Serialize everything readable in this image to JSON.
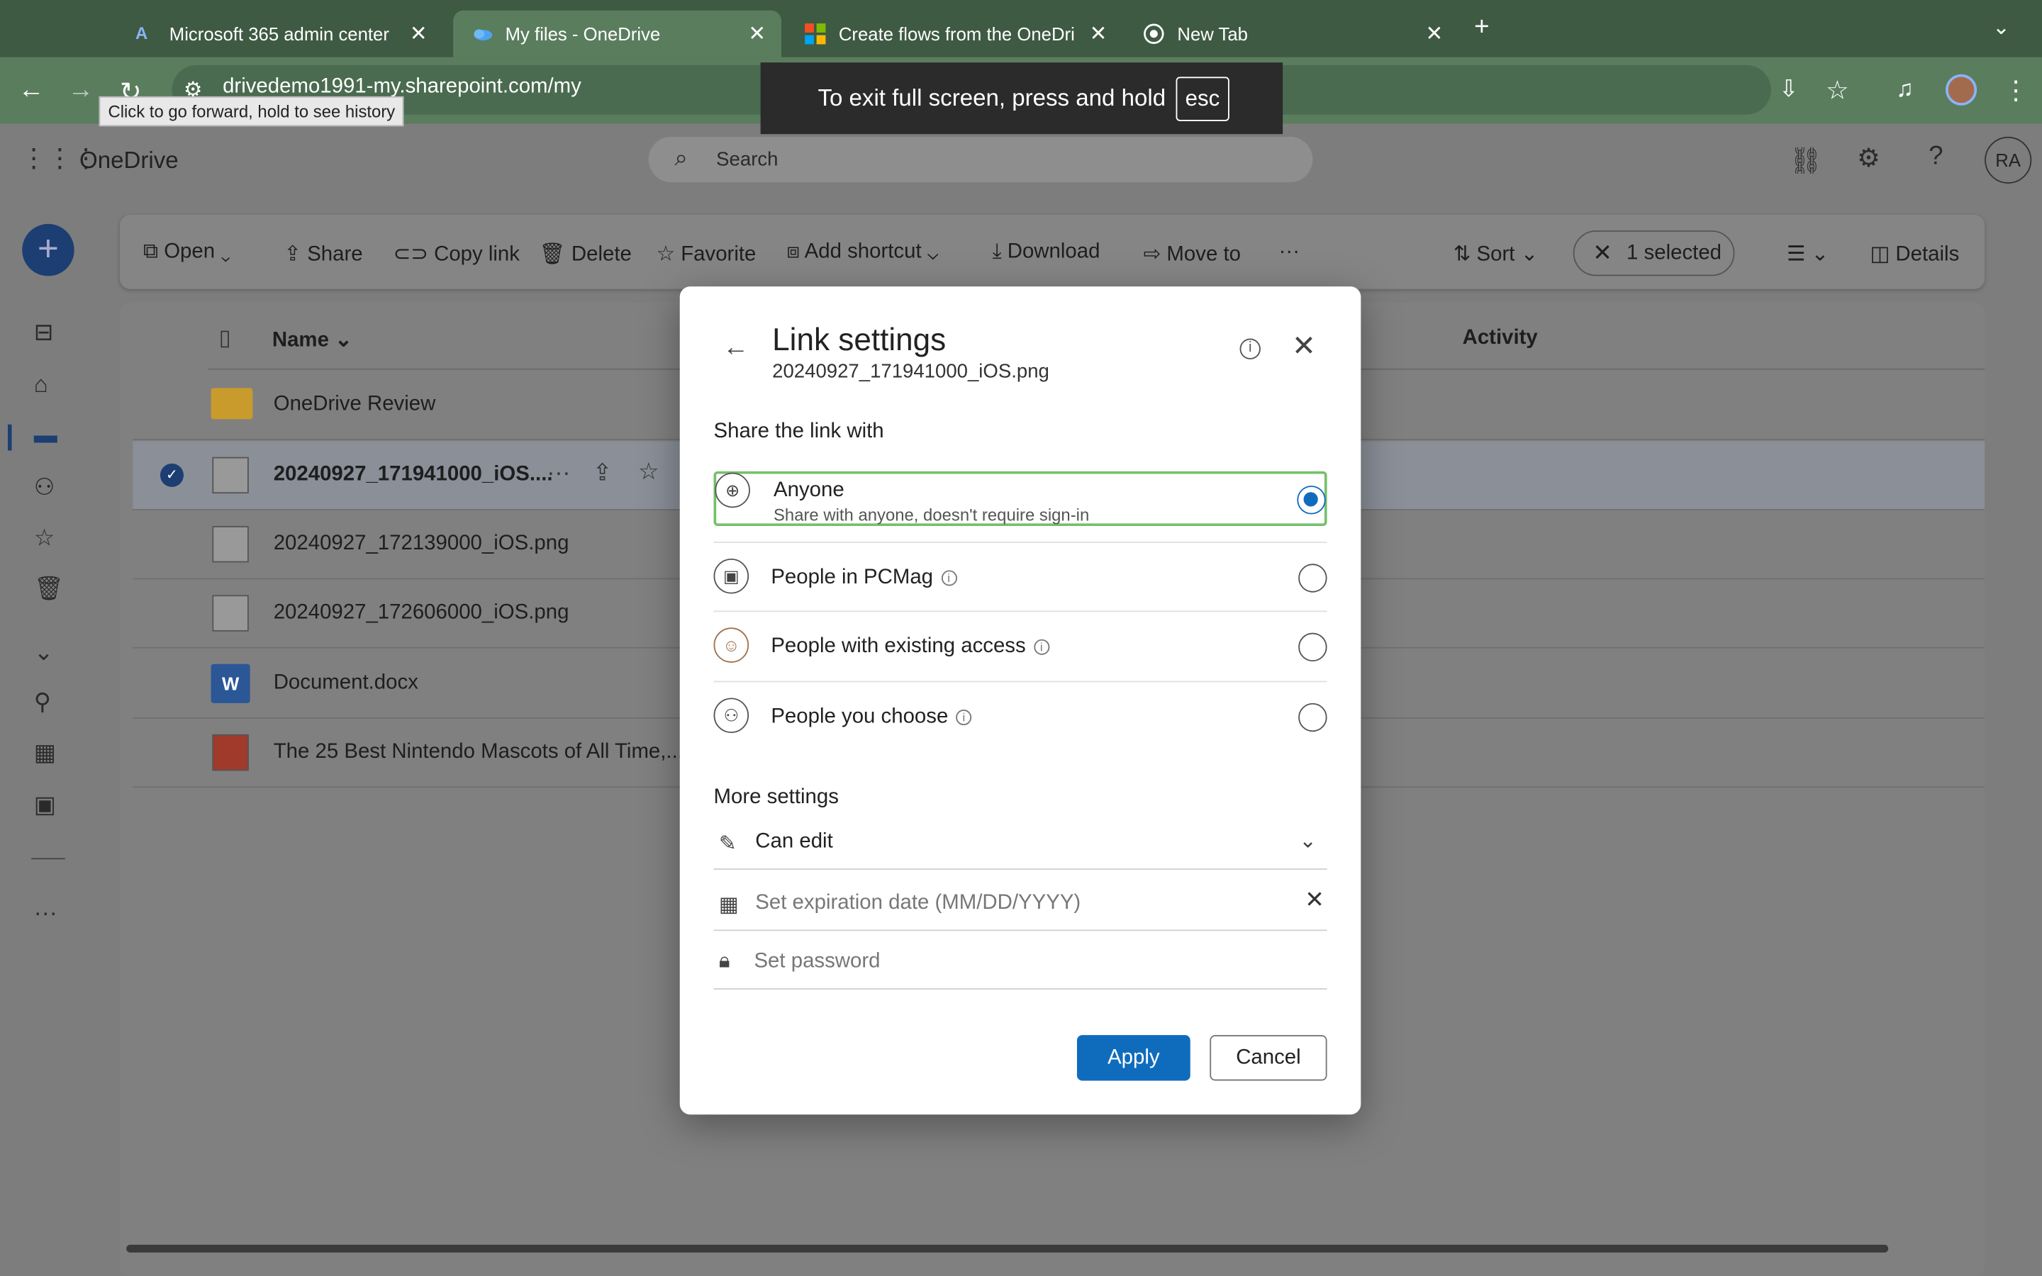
{
  "browser": {
    "tabs": [
      {
        "title": "Microsoft 365 admin center"
      },
      {
        "title": "My files - OneDrive"
      },
      {
        "title": "Create flows from the OneDri"
      },
      {
        "title": "New Tab"
      }
    ],
    "url": "drivedemo1991-my.sharepoint.com/my",
    "tooltip": "Click to go forward, hold to see history",
    "fullscreen_notice": "To exit full screen, press and hold",
    "fullscreen_key": "esc"
  },
  "app": {
    "name": "OneDrive",
    "search_placeholder": "Search",
    "avatar_initials": "RA"
  },
  "toolbar": {
    "open": "Open",
    "share": "Share",
    "copy_link": "Copy link",
    "delete": "Delete",
    "favorite": "Favorite",
    "add_shortcut": "Add shortcut",
    "download": "Download",
    "move_to": "Move to",
    "more": "···",
    "sort": "Sort",
    "selected": "1 selected",
    "details": "Details"
  },
  "list": {
    "col_name": "Name",
    "col_activity": "Activity",
    "rows": [
      {
        "name": "OneDrive Review",
        "type": "folder-icon"
      },
      {
        "name": "20240927_171941000_iOS....",
        "type": "image-file-icon"
      },
      {
        "name": "20240927_172139000_iOS.png",
        "type": "image-file-icon"
      },
      {
        "name": "20240927_172606000_iOS.png",
        "type": "image-file-icon"
      },
      {
        "name": "Document.docx",
        "type": "word-file-icon"
      },
      {
        "name": "The 25 Best Nintendo Mascots of All Time,...",
        "type": "pdf-file-icon"
      }
    ]
  },
  "dialog": {
    "title": "Link settings",
    "filename": "20240927_171941000_iOS.png",
    "share_with_heading": "Share the link with",
    "options": [
      {
        "label": "Anyone",
        "desc": "Share with anyone, doesn't require sign-in",
        "selected": true
      },
      {
        "label": "People in PCMag",
        "selected": false
      },
      {
        "label": "People with existing access",
        "selected": false
      },
      {
        "label": "People you choose",
        "selected": false
      }
    ],
    "more_settings_heading": "More settings",
    "permission": "Can edit",
    "expiration_placeholder": "Set expiration date (MM/DD/YYYY)",
    "password_placeholder": "Set password",
    "apply": "Apply",
    "cancel": "Cancel"
  },
  "colors": {
    "accent": "#0f6cbd",
    "selected_border": "#76c06b",
    "chrome": "#3e5a43"
  }
}
